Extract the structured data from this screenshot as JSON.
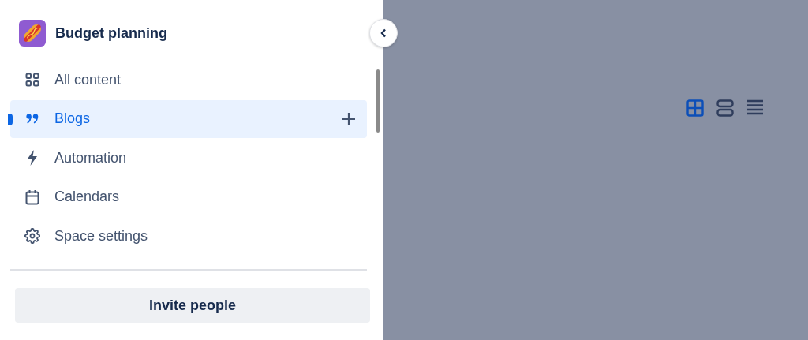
{
  "space": {
    "title": "Budget planning"
  },
  "nav_items": [
    {
      "label": "All content",
      "selected": false
    },
    {
      "label": "Blogs",
      "selected": true
    },
    {
      "label": "Automation",
      "selected": false
    },
    {
      "label": "Calendars",
      "selected": false
    },
    {
      "label": "Space settings",
      "selected": false
    }
  ],
  "invite_button": {
    "label": "Invite people"
  },
  "view_toggles": [
    {
      "selected": true
    },
    {
      "selected": false
    },
    {
      "selected": false
    }
  ]
}
